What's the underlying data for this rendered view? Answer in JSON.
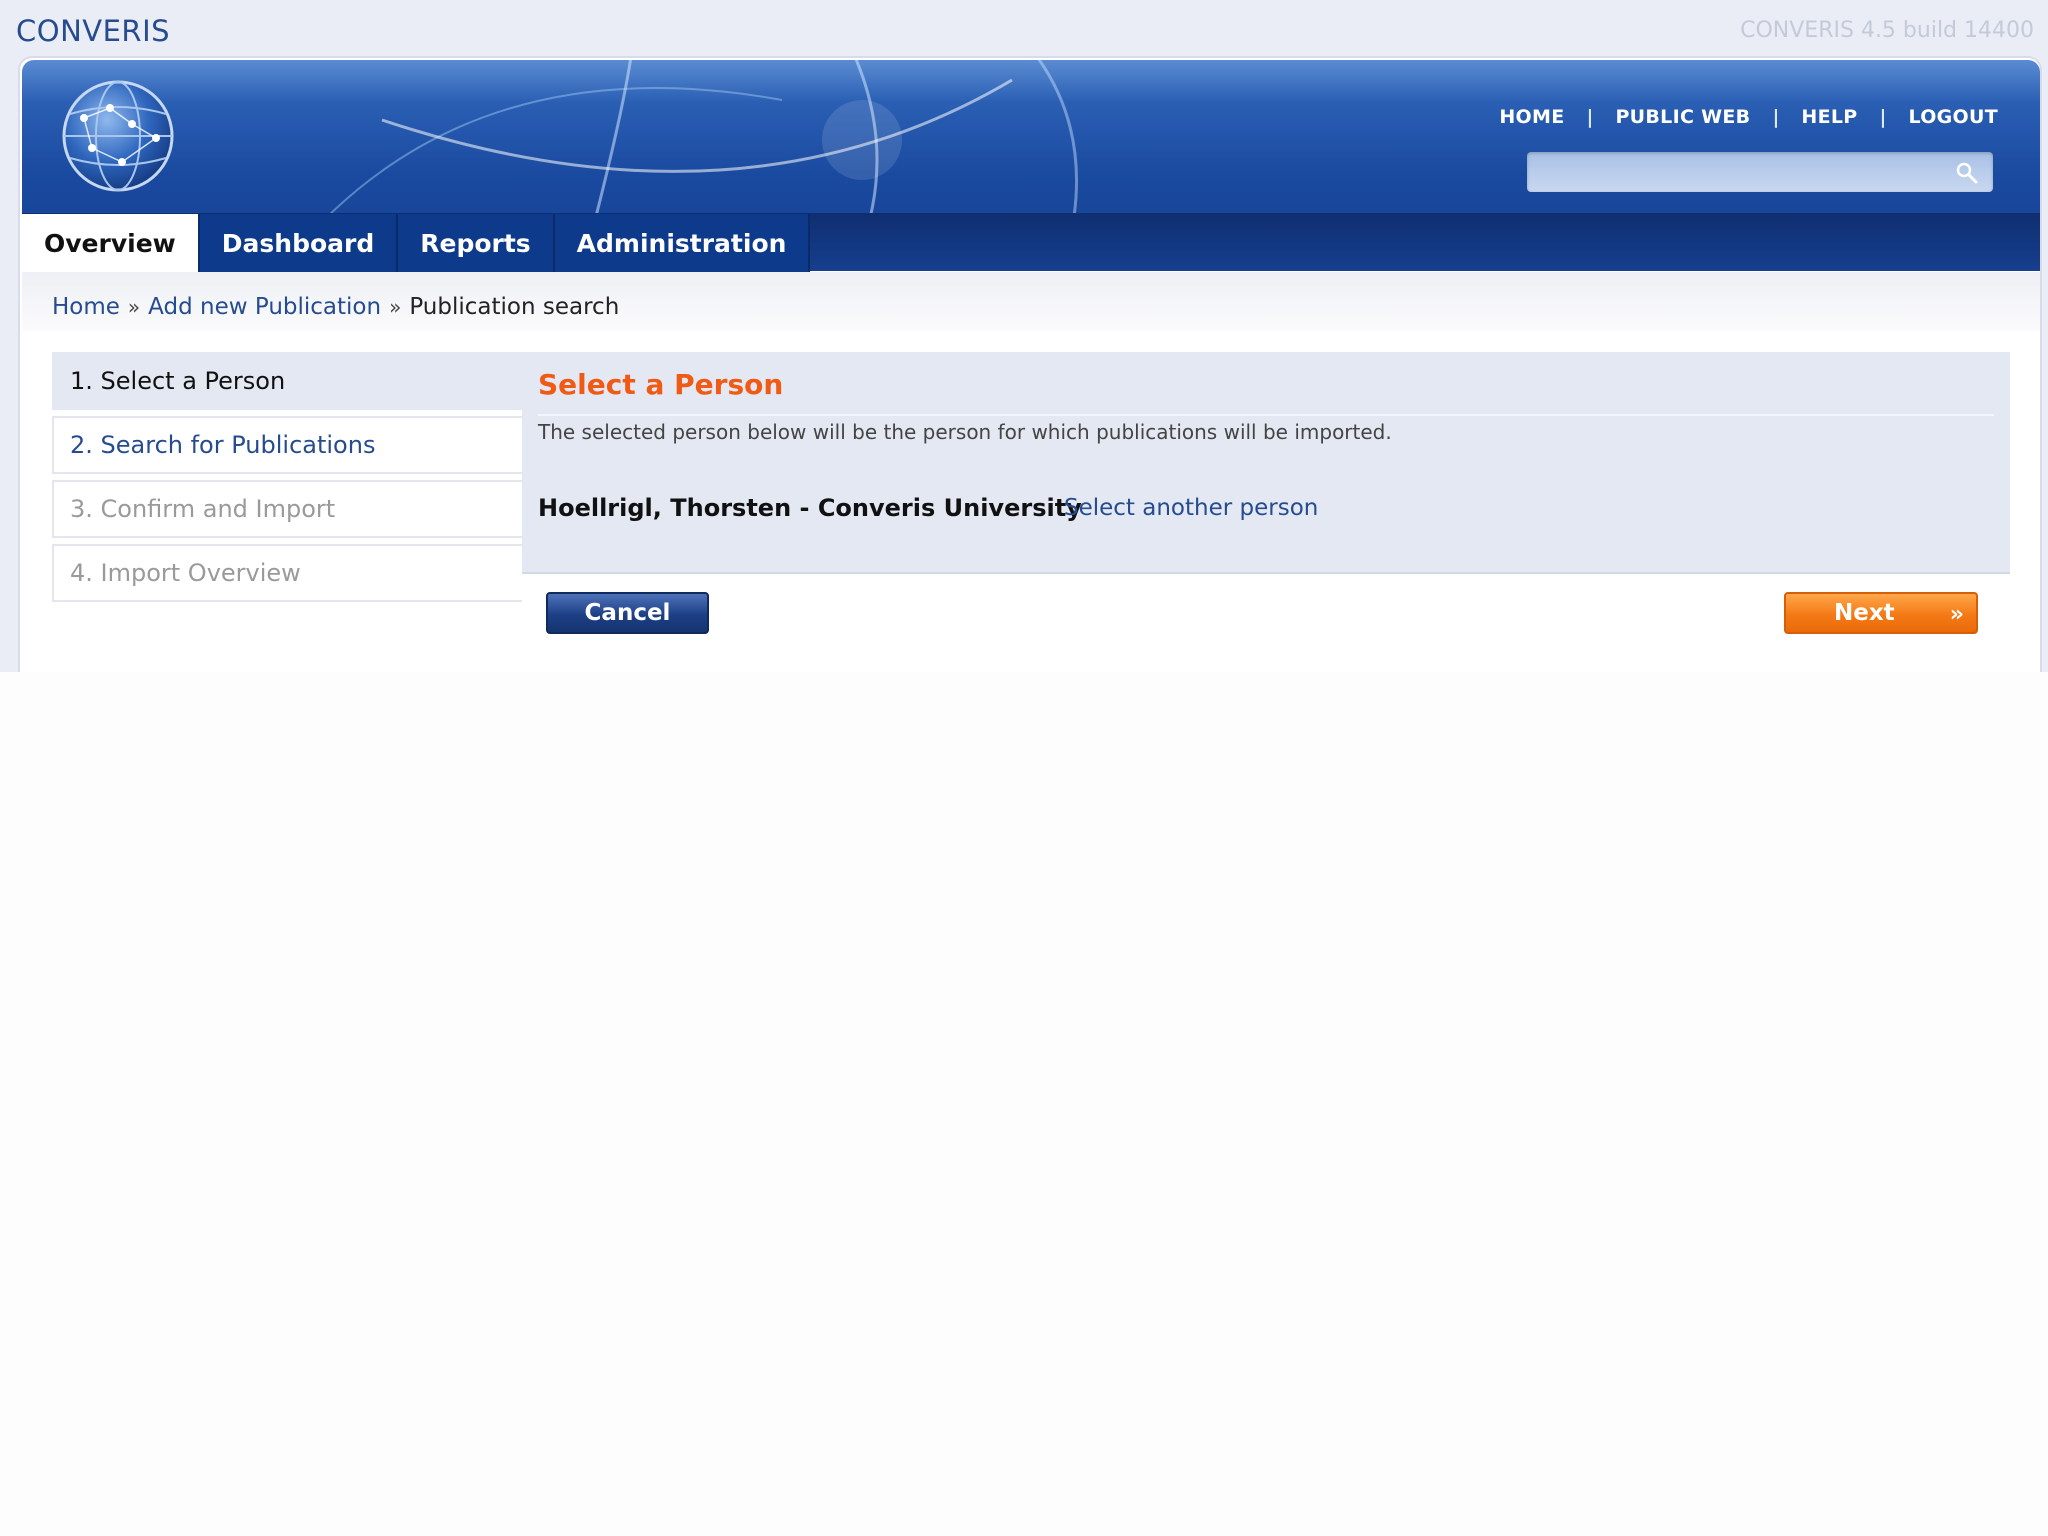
{
  "app": {
    "brand": "CONVERIS",
    "build": "CONVERIS 4.5 build 14400"
  },
  "header": {
    "links": [
      "HOME",
      "PUBLIC WEB",
      "HELP",
      "LOGOUT"
    ],
    "separator": "|",
    "search": {
      "value": "",
      "placeholder": "",
      "icon": "search-icon"
    }
  },
  "tabs": [
    {
      "label": "Overview",
      "active": true
    },
    {
      "label": "Dashboard",
      "active": false
    },
    {
      "label": "Reports",
      "active": false
    },
    {
      "label": "Administration",
      "active": false
    }
  ],
  "breadcrumb": {
    "items": [
      "Home",
      "Add new Publication",
      "Publication search"
    ],
    "separator": "»"
  },
  "steps": [
    {
      "label": "1. Select a Person",
      "state": "current"
    },
    {
      "label": "2. Search for Publications",
      "state": "next"
    },
    {
      "label": "3. Confirm and Import",
      "state": "disabled"
    },
    {
      "label": "4. Import Overview",
      "state": "disabled"
    }
  ],
  "panel": {
    "title": "Select a Person",
    "description": "The selected person below will be the person for which publications will be imported.",
    "person": "Hoellrigl, Thorsten - Converis University",
    "select_another": "Select another person"
  },
  "buttons": {
    "cancel": "Cancel",
    "next": "Next",
    "next_icon": "»"
  },
  "colors": {
    "accent_orange": "#f05a14",
    "link_blue": "#264c8f",
    "nav_blue": "#0e3a8c"
  }
}
